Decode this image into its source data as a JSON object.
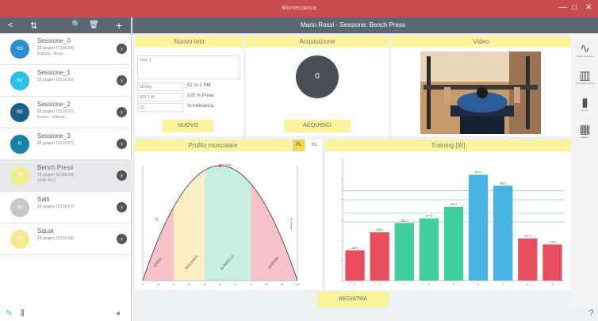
{
  "window": {
    "title": "Biomeccanica",
    "controls": [
      "—",
      "□",
      "✕"
    ]
  },
  "sidebar": {
    "toolbar": {
      "back": "<",
      "sort": "⇅",
      "search": "🔍",
      "delete": "🗑",
      "add": "+"
    },
    "sessions": [
      {
        "initials": "RS",
        "name": "Sessione_0",
        "line1": "26 giugno 15 [09:54]",
        "line2": "braccio - flessi...",
        "color": "#2a8fd2"
      },
      {
        "initials": "SV",
        "name": "Sessione_1",
        "line1": "26 giugno 15 [10:53]",
        "line2": "",
        "color": "#29c1ea"
      },
      {
        "initials": "RE",
        "name": "Sessione_2",
        "line1": "26 giugno 15 [16:07]",
        "line2": "tronco - estensi...",
        "color": "#1a5f8a"
      },
      {
        "initials": "R",
        "name": "Sessione_3",
        "line1": "26 giugno 15 [16:07]",
        "line2": "",
        "color": "#1583a7"
      },
      {
        "initials": "TR",
        "name": "Bench Press",
        "line1": "26 giugno 15 [09:54]",
        "line2": "1RM: 60.0",
        "color": "#f4ec8c"
      },
      {
        "initials": "JU",
        "name": "Salti",
        "line1": "26 giugno 15 [16:07]",
        "line2": "",
        "color": "#c8c8c8"
      },
      {
        "initials": "TR",
        "name": "Squat",
        "line1": "26 giugno 15 [16:08]",
        "line2": "",
        "color": "#f4ec8c"
      }
    ],
    "footer": {
      "edit": "✎",
      "chart": "⫼",
      "back": "◂"
    }
  },
  "header": {
    "title": "Mario Rossi - Sessione: Bench Press"
  },
  "nuovo_test": {
    "title": "Nuovo test",
    "name_value": "Test_1",
    "fields": [
      {
        "value": "25,0kg",
        "label": "51 % 1 RM"
      },
      {
        "value": "523,5 W",
        "label": "100 % Pmax"
      },
      {
        "value": "20",
        "label": "% tolleranza"
      }
    ],
    "button": "NUOVO"
  },
  "acquisizione": {
    "title": "Acquisizione",
    "counter": "0",
    "button": "ACQUISICI"
  },
  "video": {
    "title": "Video"
  },
  "profilo": {
    "title": "Profilo muscolare",
    "pl": "PL",
    "vl": "VL",
    "peak_label": "% max",
    "y_left_label": "N",
    "y_right_label": "% Fmax",
    "zones": [
      "SPEED",
      "ESPLOSIVA",
      "DI ANNELLO",
      "MASSIMA"
    ]
  },
  "training": {
    "title": "Training [W]"
  },
  "register_button": "REGISTRA",
  "tools": [
    {
      "icon": "∿",
      "label": "Profilo muscolare"
    },
    {
      "icon": "▥",
      "label": "Test Progressione"
    },
    {
      "icon": "▮",
      "label": "Report"
    },
    {
      "icon": "▦",
      "label": "Dataset"
    }
  ],
  "help": "?",
  "chart_data": [
    {
      "type": "area",
      "title": "Profilo muscolare",
      "x": [
        0,
        10,
        20,
        30,
        40,
        50,
        60,
        70,
        80,
        90,
        100
      ],
      "y_right": [
        0,
        36,
        64,
        84,
        96,
        100,
        96,
        84,
        64,
        36,
        0
      ],
      "xlim": [
        0,
        100
      ],
      "ylim_right": [
        0,
        100
      ],
      "zones": [
        "SPEED",
        "ESPLOSIVA",
        "DI ANNELLO",
        "MASSIMA"
      ]
    },
    {
      "type": "bar",
      "title": "Training [W]",
      "categories": [
        "1",
        "2",
        "3",
        "4",
        "5",
        "6",
        "7",
        "8",
        "9"
      ],
      "values": [
        149.6,
        238.8,
        285.1,
        307.8,
        365.2,
        523.5,
        469.2,
        207.9,
        178.6
      ],
      "value_labels": [
        "149.6",
        "238.8",
        "285.1",
        "307.8",
        "365.2",
        "523.5",
        "469.2",
        "207.9",
        "178.6"
      ],
      "colors": [
        "#e94d5c",
        "#e94d5c",
        "#3fcf9d",
        "#3fcf9d",
        "#3fcf9d",
        "#4ab3e6",
        "#4ab3e6",
        "#e94d5c",
        "#e94d5c"
      ],
      "ylim": [
        0,
        600
      ],
      "reference_lines": [
        {
          "value": 445,
          "color": "#a8d8ef"
        },
        {
          "value": 400,
          "color": "#a8d8ef"
        },
        {
          "value": 333,
          "color": "#b5ead8"
        },
        {
          "value": 290,
          "color": "#f5b9c0"
        }
      ]
    }
  ]
}
